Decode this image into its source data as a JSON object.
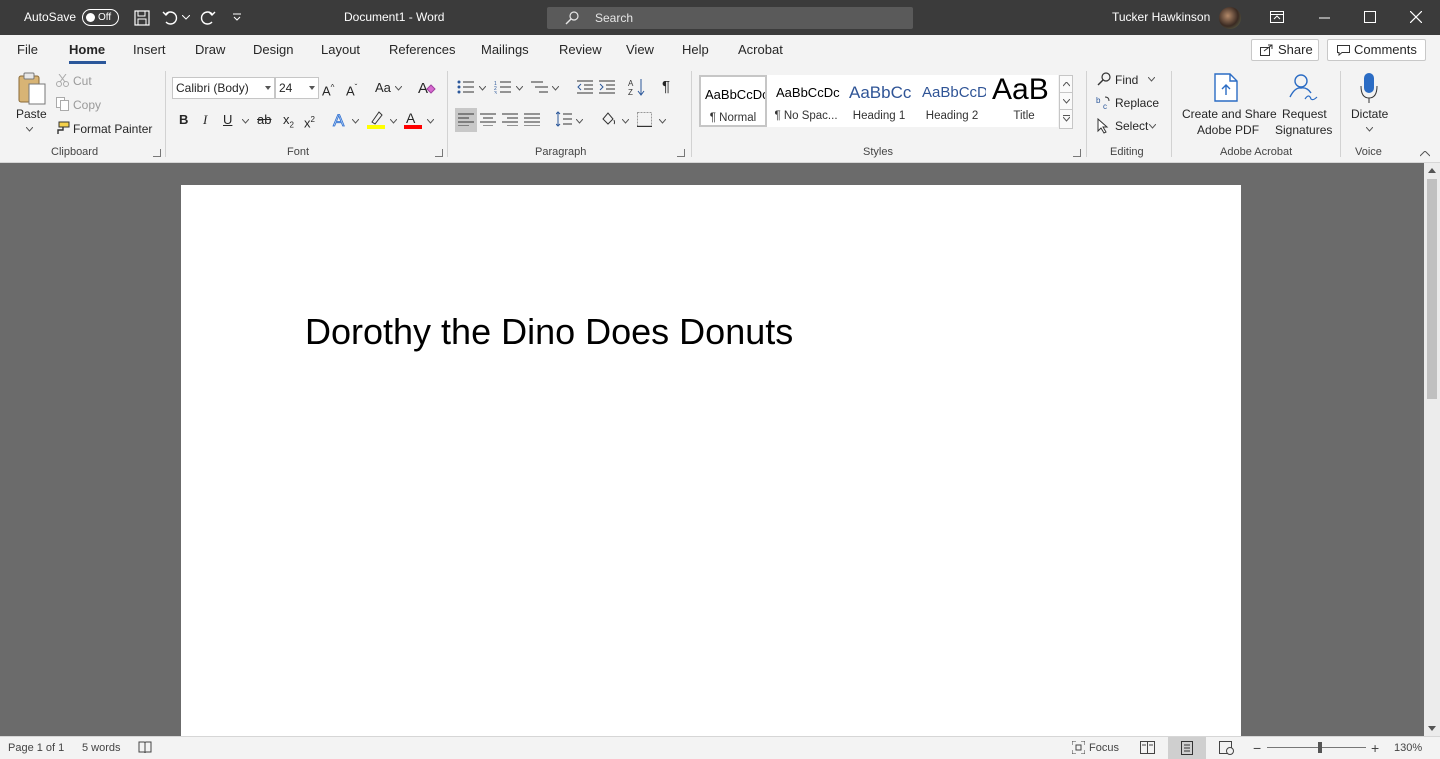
{
  "titlebar": {
    "autosave_label": "AutoSave",
    "autosave_state": "Off",
    "document_title": "Document1 - Word",
    "search_placeholder": "Search",
    "user_name": "Tucker Hawkinson"
  },
  "tabs": [
    "File",
    "Home",
    "Insert",
    "Draw",
    "Design",
    "Layout",
    "References",
    "Mailings",
    "Review",
    "View",
    "Help",
    "Acrobat"
  ],
  "active_tab": "Home",
  "share_label": "Share",
  "comments_label": "Comments",
  "clipboard": {
    "paste": "Paste",
    "cut": "Cut",
    "copy": "Copy",
    "format_painter": "Format Painter",
    "group_label": "Clipboard"
  },
  "font": {
    "family": "Calibri (Body)",
    "size": "24",
    "change_case": "Aa",
    "bold": "B",
    "italic": "I",
    "underline": "U",
    "strike": "ab",
    "group_label": "Font"
  },
  "paragraph": {
    "group_label": "Paragraph"
  },
  "styles": {
    "items": [
      {
        "preview": "AaBbCcDc",
        "name": "¶ Normal"
      },
      {
        "preview": "AaBbCcDc",
        "name": "¶ No Spac..."
      },
      {
        "preview": "AaBbCc",
        "name": "Heading 1"
      },
      {
        "preview": "AaBbCcD",
        "name": "Heading 2"
      },
      {
        "preview": "AaB",
        "name": "Title"
      }
    ],
    "group_label": "Styles"
  },
  "editing": {
    "find": "Find",
    "replace": "Replace",
    "select": "Select",
    "group_label": "Editing"
  },
  "acrobat": {
    "create_share_line1": "Create and Share",
    "create_share_line2": "Adobe PDF",
    "request_line1": "Request",
    "request_line2": "Signatures",
    "group_label": "Adobe Acrobat"
  },
  "voice": {
    "dictate": "Dictate",
    "group_label": "Voice"
  },
  "document": {
    "title_text": "Dorothy the Dino Does Donuts"
  },
  "statusbar": {
    "page": "Page 1 of 1",
    "words": "5 words",
    "focus": "Focus",
    "zoom": "130%"
  },
  "colors": {
    "titlebar": "#3b3b3b",
    "ribbon": "#f3f3f3",
    "accent": "#2b579a",
    "highlight": "#ffff00",
    "font_color": "#ff0000"
  }
}
